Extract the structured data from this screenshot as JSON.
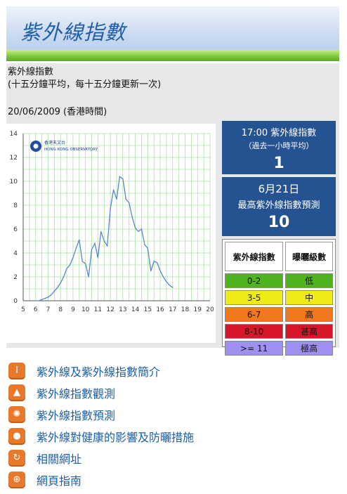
{
  "banner": {
    "title": "紫外線指數"
  },
  "header": {
    "line1": "紫外線指數",
    "line2": "(十五分鐘平均，每十五分鐘更新一次)",
    "date": "20/06/2009 (香港時間)"
  },
  "current": {
    "line1": "17:00 紫外線指數",
    "line2": "（過去一小時平均）",
    "value": "1"
  },
  "forecast": {
    "line1": "6月21日",
    "line2": "最高紫外線指數預測",
    "value": "10"
  },
  "legend": {
    "col1": "紫外線指數",
    "col2": "曝曬級數",
    "rows": [
      {
        "range": "0-2",
        "level": "低",
        "color": "#4fb21f"
      },
      {
        "range": "3-5",
        "level": "中",
        "color": "#f0ea17"
      },
      {
        "range": "6-7",
        "level": "高",
        "color": "#f0781e"
      },
      {
        "range": "8-10",
        "level": "甚高",
        "color": "#d8162a"
      },
      {
        "range": ">= 11",
        "level": "極高",
        "color": "#9f8ff0"
      }
    ]
  },
  "links": [
    {
      "icon": "info-icon",
      "label": "紫外線及紫外線指數簡介"
    },
    {
      "icon": "chart-icon",
      "label": "紫外線指數觀測"
    },
    {
      "icon": "sun-icon",
      "label": "紫外線指數預測"
    },
    {
      "icon": "person-icon",
      "label": "紫外線對健康的影響及防曬措施"
    },
    {
      "icon": "link-icon",
      "label": "相關網址"
    },
    {
      "icon": "globe-icon",
      "label": "網頁指南"
    }
  ],
  "chart_data": {
    "type": "line",
    "logo_text": [
      "香港天文台",
      "HONG KONG OBSERVATORY"
    ],
    "xlim": [
      5,
      20
    ],
    "ylim": [
      0,
      14
    ],
    "x_ticks": [
      5,
      6,
      7,
      8,
      9,
      10,
      11,
      12,
      13,
      14,
      15,
      16,
      17,
      18,
      19,
      20
    ],
    "y_ticks": [
      0,
      2,
      4,
      6,
      8,
      10,
      12,
      14
    ],
    "grid": true,
    "series_color": "#5a87c8",
    "x": [
      6.0,
      6.25,
      6.5,
      6.75,
      7.0,
      7.25,
      7.5,
      7.75,
      8.0,
      8.25,
      8.5,
      8.75,
      9.0,
      9.25,
      9.5,
      9.75,
      10.0,
      10.25,
      10.5,
      10.75,
      11.0,
      11.25,
      11.5,
      11.75,
      12.0,
      12.25,
      12.5,
      12.75,
      13.0,
      13.25,
      13.5,
      13.75,
      14.0,
      14.25,
      14.5,
      14.75,
      15.0,
      15.25,
      15.5,
      15.75,
      16.0,
      16.25,
      16.5,
      16.75,
      17.0
    ],
    "y": [
      0.0,
      0.0,
      0.1,
      0.2,
      0.3,
      0.5,
      0.8,
      1.1,
      1.5,
      2.0,
      2.7,
      3.0,
      3.6,
      4.4,
      5.1,
      3.3,
      3.1,
      2.0,
      4.3,
      4.8,
      3.6,
      5.8,
      5.0,
      4.6,
      7.7,
      9.3,
      8.5,
      10.4,
      10.2,
      8.5,
      8.2,
      7.0,
      6.1,
      5.8,
      6.0,
      4.7,
      4.4,
      2.5,
      3.3,
      3.2,
      2.5,
      2.0,
      1.6,
      1.3,
      1.1
    ]
  }
}
